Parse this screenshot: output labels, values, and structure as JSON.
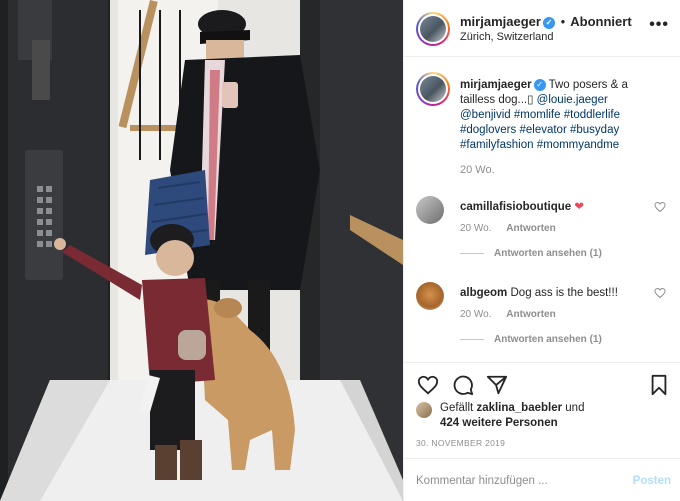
{
  "header": {
    "username": "mirjamjaeger",
    "separator": "•",
    "follow_label": "Abonniert",
    "location": "Zürich, Switzerland",
    "more_icon": "more-options-icon"
  },
  "caption": {
    "username": "mirjamjaeger",
    "text": " Two posers & a tailless dog...",
    "emoji": "▯",
    "mentions": [
      "@louie.jaeger",
      "@benjivid"
    ],
    "hashtags": [
      "#momlife",
      "#toddlerlife",
      "#doglovers",
      "#elevator",
      "#busyday",
      "#familyfashion",
      "#mommyandme"
    ],
    "time": "20 Wo."
  },
  "comments": [
    {
      "username": "camillafisioboutique",
      "text": "",
      "emoji": "❤",
      "time": "20 Wo.",
      "reply_label": "Antworten",
      "replies_label": "Antworten ansehen (1)"
    },
    {
      "username": "albgeom",
      "text": "Dog ass is the best!!!",
      "time": "20 Wo.",
      "reply_label": "Antworten",
      "replies_label": "Antworten ansehen (1)"
    }
  ],
  "actions": {
    "icons": [
      "heart-icon",
      "comment-icon",
      "share-icon",
      "bookmark-icon"
    ]
  },
  "likes": {
    "prefix": "Gefällt ",
    "user": "zaklina_baebler",
    "middle": " und",
    "count_text": "424 weitere Personen"
  },
  "date": "30. NOVEMBER 2019",
  "add_comment": {
    "placeholder": "Kommentar hinzufügen ...",
    "post_label": "Posten"
  },
  "colors": {
    "link": "#00376b",
    "verified": "#3897f0",
    "muted": "#8e8e8e",
    "post_disabled": "#b2dffc",
    "heart": "#ed4956"
  }
}
